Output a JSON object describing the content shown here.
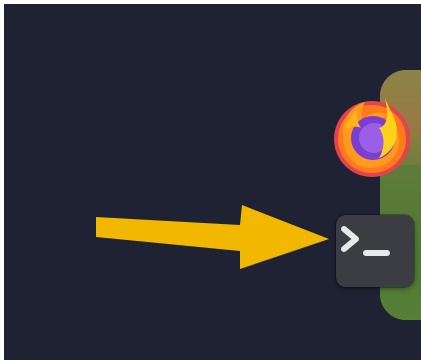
{
  "desktop": {
    "background_color": "#1e2233"
  },
  "dock": {
    "apps": [
      {
        "name": "Firefox",
        "icon": "firefox-icon"
      },
      {
        "name": "Terminal",
        "icon": "terminal-icon"
      }
    ]
  },
  "annotation": {
    "arrow_color": "#f2b800",
    "points_to": "terminal-icon"
  }
}
